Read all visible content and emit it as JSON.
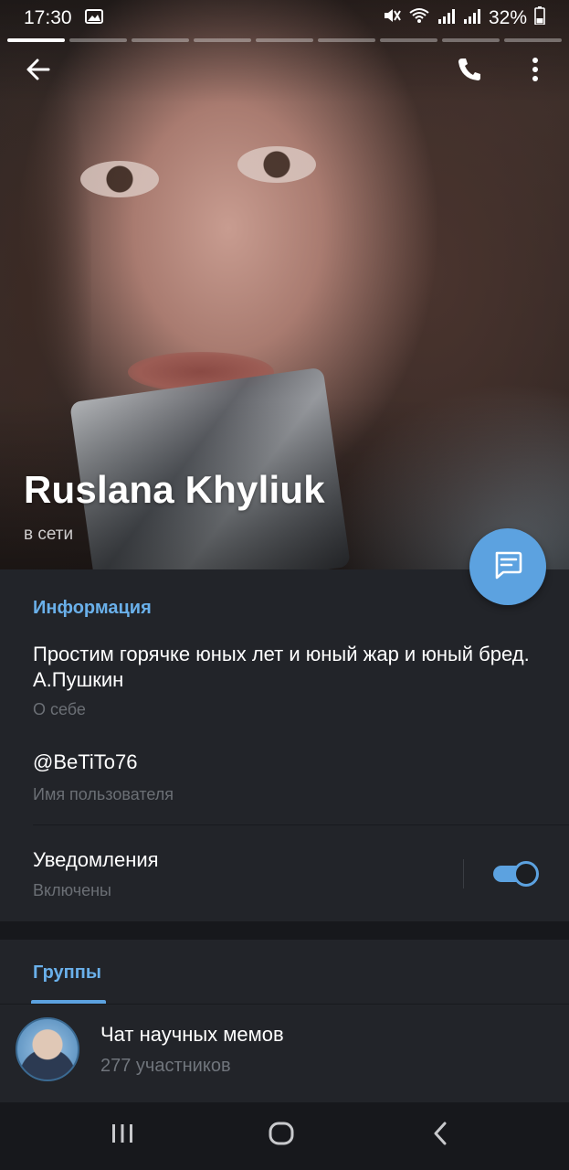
{
  "status_bar": {
    "time": "17:30",
    "battery": "32%",
    "icons": [
      "gallery-icon",
      "mute-icon",
      "wifi-icon",
      "signal-icon",
      "signal-icon",
      "battery-icon"
    ]
  },
  "story_segments": 9,
  "toolbar": {
    "back_icon": "arrow-left-icon",
    "call_icon": "phone-icon",
    "menu_icon": "more-vertical-icon"
  },
  "profile": {
    "name": "Ruslana Khyliuk",
    "status": "в сети"
  },
  "fab": {
    "icon": "message-icon"
  },
  "info": {
    "header": "Информация",
    "bio": "Простим горячке юных лет и юный жар и юный бред. А.Пушкин",
    "bio_label": "О себе",
    "username": "@BeTiTo76",
    "username_label": "Имя пользователя",
    "notifications": "Уведомления",
    "notifications_state": "Включены",
    "notifications_enabled": true
  },
  "groups": {
    "header": "Группы",
    "items": [
      {
        "title": "Чат научных мемов",
        "subtitle": "277 участников"
      }
    ]
  },
  "navbar": {
    "recent_icon": "recent-apps-icon",
    "home_icon": "home-icon",
    "back_icon": "nav-back-icon"
  },
  "colors": {
    "accent": "#5ca2e0",
    "section_bg": "#222429",
    "page_bg": "#17181c",
    "header_text": "#6ab0ea"
  }
}
